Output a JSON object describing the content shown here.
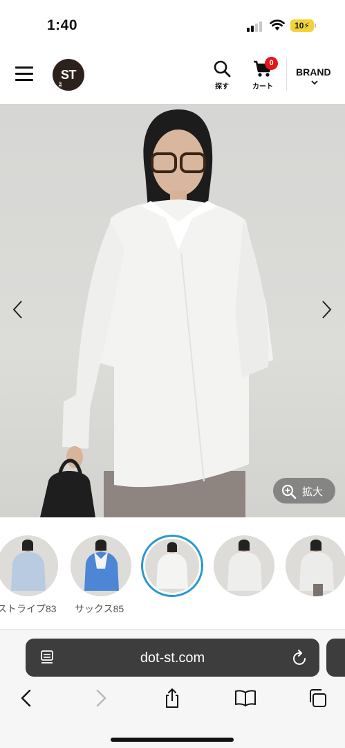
{
  "status_bar": {
    "time": "1:40",
    "battery": "10"
  },
  "header": {
    "logo_text": "ST",
    "logo_small_text": "dot",
    "search_label": "探す",
    "cart_label": "カート",
    "cart_count": "0",
    "brand_label": "BRAND"
  },
  "product": {
    "zoom_label": "拡大"
  },
  "swatches": [
    {
      "label": "ストライプ83",
      "color": "#b9cbe0"
    },
    {
      "label": "サックス85",
      "color": "#4d86d6"
    },
    {
      "label": "",
      "color": "#f2f2f2",
      "selected": true
    },
    {
      "label": "",
      "color": "#eeeeec"
    },
    {
      "label": "",
      "color": "#ececea"
    }
  ],
  "browser": {
    "url": "dot-st.com"
  },
  "icons": {
    "menu": "hamburger-menu-icon",
    "search": "search-icon",
    "cart": "cart-icon",
    "brand_dropdown": "chevron-down-icon",
    "prev": "chevron-left-icon",
    "next": "chevron-right-icon",
    "zoom": "zoom-in-icon",
    "page_settings": "page-menu-icon",
    "reload": "reload-icon",
    "back": "back-icon",
    "forward": "forward-icon",
    "share": "share-icon",
    "bookmarks": "book-icon",
    "tabs": "tabs-icon"
  },
  "colors": {
    "accent_selected": "#2b98d0",
    "cart_badge": "#e5151b",
    "logo_bg": "#2d211c"
  }
}
